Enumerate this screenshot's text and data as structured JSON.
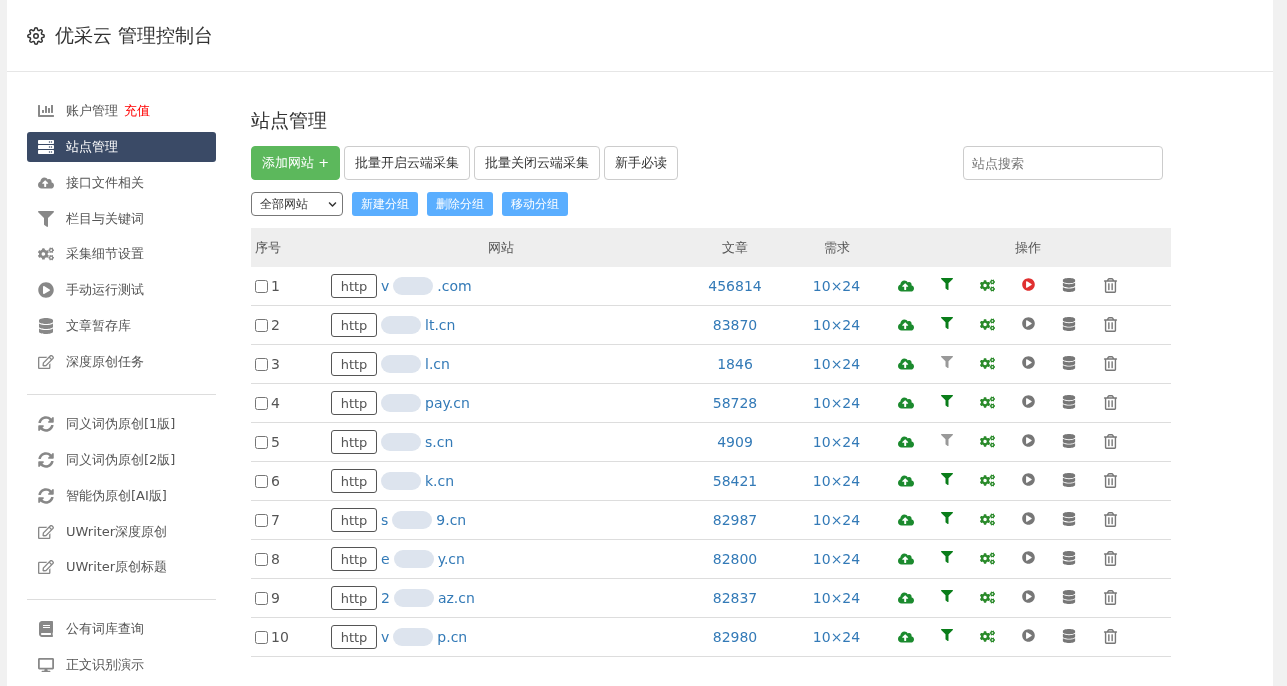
{
  "header": {
    "title": "优采云 管理控制台"
  },
  "sidebar": {
    "groups": [
      {
        "items": [
          {
            "label": "账户管理",
            "badge": "充值",
            "selected": false
          },
          {
            "label": "站点管理",
            "selected": true
          },
          {
            "label": "接口文件相关",
            "selected": false
          },
          {
            "label": "栏目与关键词",
            "selected": false
          },
          {
            "label": "采集细节设置",
            "selected": false
          },
          {
            "label": "手动运行测试",
            "selected": false
          },
          {
            "label": "文章暂存库",
            "selected": false
          },
          {
            "label": "深度原创任务",
            "selected": false
          }
        ]
      },
      {
        "items": [
          {
            "label": "同义词伪原创[1版]",
            "selected": false
          },
          {
            "label": "同义词伪原创[2版]",
            "selected": false
          },
          {
            "label": "智能伪原创[AI版]",
            "selected": false
          },
          {
            "label": "UWriter深度原创",
            "selected": false
          },
          {
            "label": "UWriter原创标题",
            "selected": false
          }
        ]
      },
      {
        "items": [
          {
            "label": "公有词库查询",
            "selected": false
          },
          {
            "label": "正文识别演示",
            "selected": false
          }
        ]
      }
    ]
  },
  "main": {
    "title": "站点管理",
    "toolbar": [
      {
        "label": "添加网站 +",
        "kind": "primary"
      },
      {
        "label": "批量开启云端采集",
        "kind": "default"
      },
      {
        "label": "批量关闭云端采集",
        "kind": "default"
      },
      {
        "label": "新手必读",
        "kind": "default"
      }
    ],
    "search": {
      "placeholder": "站点搜索"
    },
    "group_select": {
      "value": "全部网站"
    },
    "group_buttons": [
      "新建分组",
      "删除分组",
      "移动分组"
    ],
    "table": {
      "columns": [
        "序号",
        "网站",
        "文章",
        "需求",
        "操作"
      ],
      "rows": [
        {
          "index": "1",
          "checked": false,
          "protocol": "http",
          "domain_start": "v",
          "domain_end": ".com",
          "articles": "456814",
          "demand": "10×24",
          "filter_on": true,
          "running": true
        },
        {
          "index": "2",
          "checked": false,
          "protocol": "http",
          "domain_start": "",
          "domain_end": "lt.cn",
          "articles": "83870",
          "demand": "10×24",
          "filter_on": true,
          "running": false
        },
        {
          "index": "3",
          "checked": false,
          "protocol": "http",
          "domain_start": "",
          "domain_end": "l.cn",
          "articles": "1846",
          "demand": "10×24",
          "filter_on": false,
          "running": false
        },
        {
          "index": "4",
          "checked": false,
          "protocol": "http",
          "domain_start": "",
          "domain_end": "pay.cn",
          "articles": "58728",
          "demand": "10×24",
          "filter_on": true,
          "running": false
        },
        {
          "index": "5",
          "checked": false,
          "protocol": "http",
          "domain_start": "",
          "domain_end": "s.cn",
          "articles": "4909",
          "demand": "10×24",
          "filter_on": false,
          "running": false
        },
        {
          "index": "6",
          "checked": false,
          "protocol": "http",
          "domain_start": "",
          "domain_end": "k.cn",
          "articles": "58421",
          "demand": "10×24",
          "filter_on": true,
          "running": false
        },
        {
          "index": "7",
          "checked": false,
          "protocol": "http",
          "domain_start": "s",
          "domain_end": "9.cn",
          "articles": "82987",
          "demand": "10×24",
          "filter_on": true,
          "running": false
        },
        {
          "index": "8",
          "checked": false,
          "protocol": "http",
          "domain_start": "e",
          "domain_end": "y.cn",
          "articles": "82800",
          "demand": "10×24",
          "filter_on": true,
          "running": false
        },
        {
          "index": "9",
          "checked": false,
          "protocol": "http",
          "domain_start": "2",
          "domain_end": "az.cn",
          "articles": "82837",
          "demand": "10×24",
          "filter_on": true,
          "running": false
        },
        {
          "index": "10",
          "checked": false,
          "protocol": "http",
          "domain_start": "v",
          "domain_end": "p.cn",
          "articles": "82980",
          "demand": "10×24",
          "filter_on": true,
          "running": false
        }
      ]
    }
  }
}
